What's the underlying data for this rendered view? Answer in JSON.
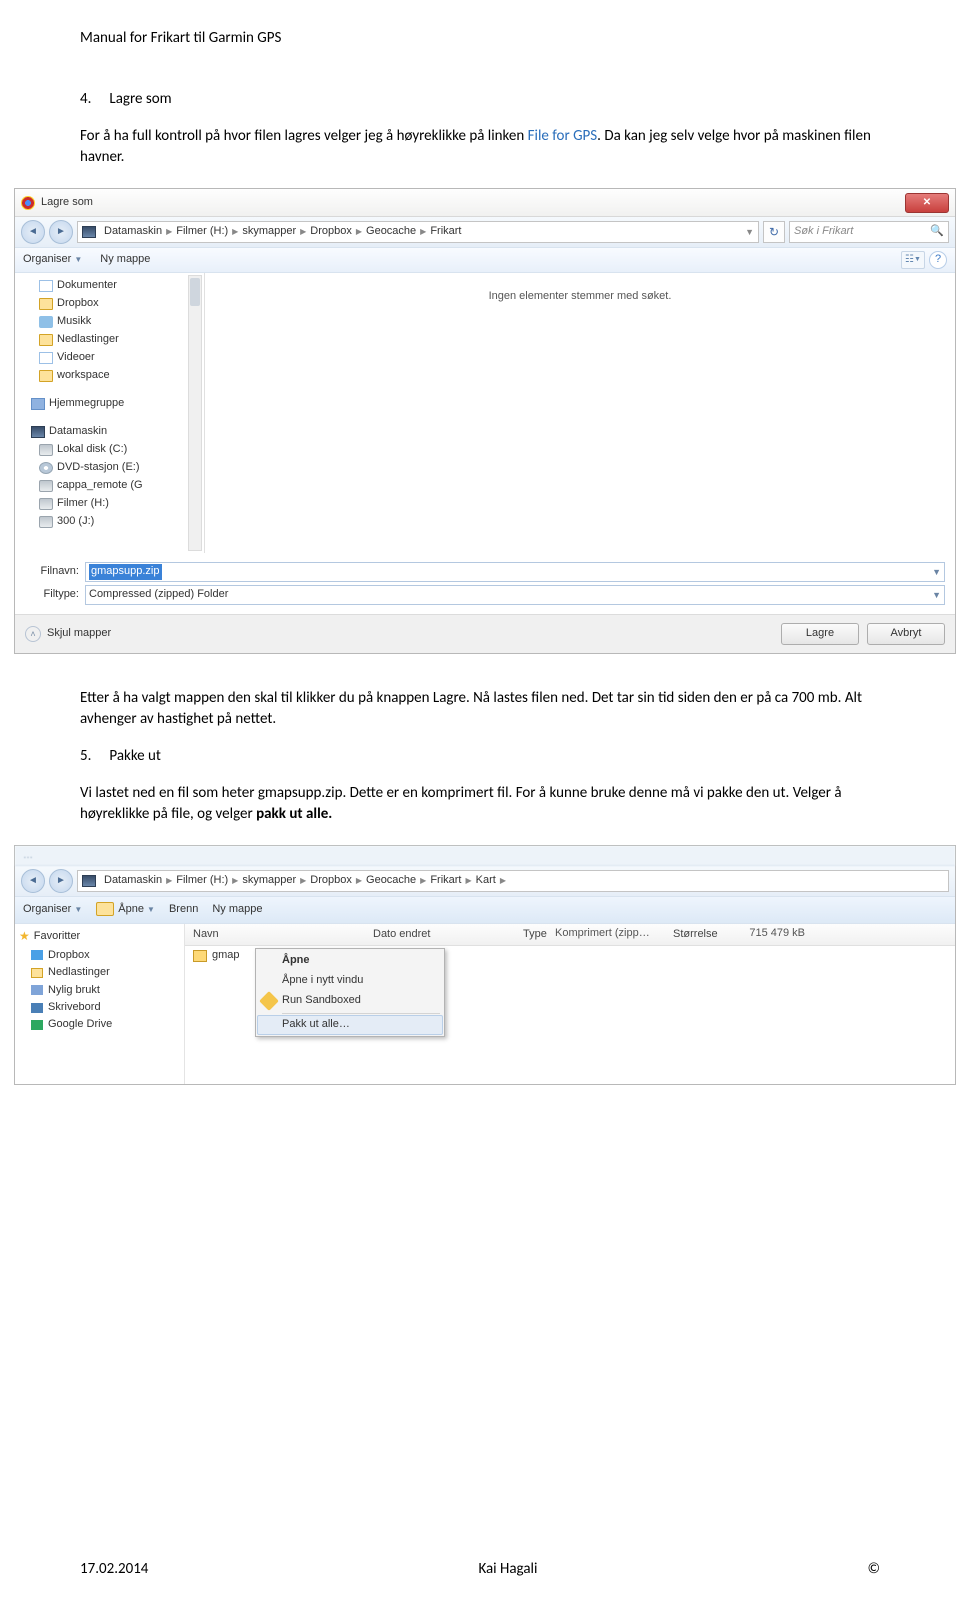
{
  "doc": {
    "title": "Manual for Frikart til Garmin GPS",
    "section4_num": "4.",
    "section4_title": "Lagre som",
    "para4_a": "For å ha full kontroll på hvor filen lagres velger jeg å høyreklikke på linken ",
    "para4_link": "File for GPS",
    "para4_b": ". Da kan jeg selv velge hvor på maskinen filen havner.",
    "para4_after": "Etter å ha valgt mappen den skal til klikker du på knappen Lagre. Nå lastes filen ned. Det tar sin tid siden den er på ca 700 mb. Alt avhenger av hastighet på nettet.",
    "section5_num": "5.",
    "section5_title": "Pakke ut",
    "para5": "Vi lastet ned en fil som heter gmapsupp.zip. Dette er en komprimert fil. For å kunne bruke denne må vi pakke den ut. Velger å høyreklikke på file, og velger ",
    "para5_bold": "pakk ut alle."
  },
  "save_dialog": {
    "title": "Lagre som",
    "breadcrumbs": [
      "Datamaskin",
      "Filmer (H:)",
      "skymapper",
      "Dropbox",
      "Geocache",
      "Frikart"
    ],
    "search_placeholder": "Søk i Frikart",
    "organize": "Organiser",
    "new_folder": "Ny mappe",
    "tree_group1": [
      "Dokumenter",
      "Dropbox",
      "Musikk",
      "Nedlastinger",
      "Videoer",
      "workspace"
    ],
    "tree_group2": [
      "Hjemmegruppe"
    ],
    "tree_group3_head": "Datamaskin",
    "tree_group3": [
      "Lokal disk (C:)",
      "DVD-stasjon (E:)",
      "cappa_remote (G",
      "Filmer (H:)",
      "300 (J:)"
    ],
    "empty": "Ingen elementer stemmer med søket.",
    "filename_label": "Filnavn:",
    "filename_value": "gmapsupp.zip",
    "filetype_label": "Filtype:",
    "filetype_value": "Compressed (zipped) Folder",
    "hide_folders": "Skjul mapper",
    "save_btn": "Lagre",
    "cancel_btn": "Avbryt"
  },
  "explorer": {
    "breadcrumbs": [
      "Datamaskin",
      "Filmer (H:)",
      "skymapper",
      "Dropbox",
      "Geocache",
      "Frikart",
      "Kart"
    ],
    "organize": "Organiser",
    "open": "Åpne",
    "burn": "Brenn",
    "new_folder": "Ny mappe",
    "fav_head": "Favoritter",
    "favs": [
      "Dropbox",
      "Nedlastinger",
      "Nylig brukt",
      "Skrivebord",
      "Google Drive"
    ],
    "col_name": "Navn",
    "col_date": "Dato endret",
    "col_type": "Type",
    "col_size": "Størrelse",
    "file_name": "gmap",
    "file_type": "Komprimert (zipp…",
    "file_size": "715 479 kB",
    "ctx": {
      "open": "Åpne",
      "newwin": "Åpne i nytt vindu",
      "sand": "Run Sandboxed",
      "extract": "Pakk ut alle…"
    }
  },
  "footer": {
    "date": "17.02.2014",
    "author": "Kai Hagali",
    "copy": "©"
  }
}
